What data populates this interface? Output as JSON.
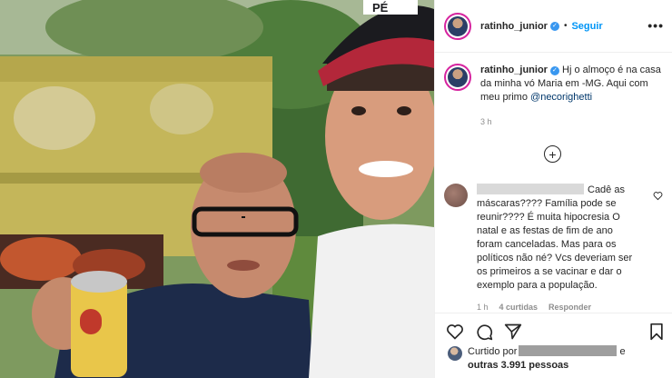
{
  "photo": {
    "cap_text": "PÉ",
    "description_alt": ""
  },
  "header": {
    "username": "ratinho_junior",
    "separator": "•",
    "follow_label": "Seguir",
    "more_icon": "more-dots-icon"
  },
  "caption": {
    "username": "ratinho_junior",
    "text": "Hj o almoço é na casa da minha vó Maria em -MG. Aqui com meu primo",
    "mention": "@necorighetti",
    "time": "3 h"
  },
  "load_more": {
    "icon": "plus-circle-icon",
    "symbol": "+"
  },
  "comment": {
    "text": "Cadê as máscaras???? Família pode se reunir???? É muita hipocresia O natal e as festas de fim de ano foram canceladas. Mas para os políticos não né? Vcs deveriam ser os primeiros a se vacinar e dar o exemplo para a população.",
    "time": "1 h",
    "likes": "4 curtidas",
    "reply_label": "Responder"
  },
  "actions": {
    "like_icon": "heart-icon",
    "comment_icon": "comment-icon",
    "share_icon": "share-icon",
    "save_icon": "bookmark-icon"
  },
  "liked_by": {
    "prefix": "Curtido por",
    "suffix": "e",
    "others": "outras 3.991 pessoas"
  },
  "colors": {
    "link_blue": "#0095f6",
    "verified_blue": "#3897f0",
    "muted": "#8e8e8e",
    "border": "#efefef"
  }
}
